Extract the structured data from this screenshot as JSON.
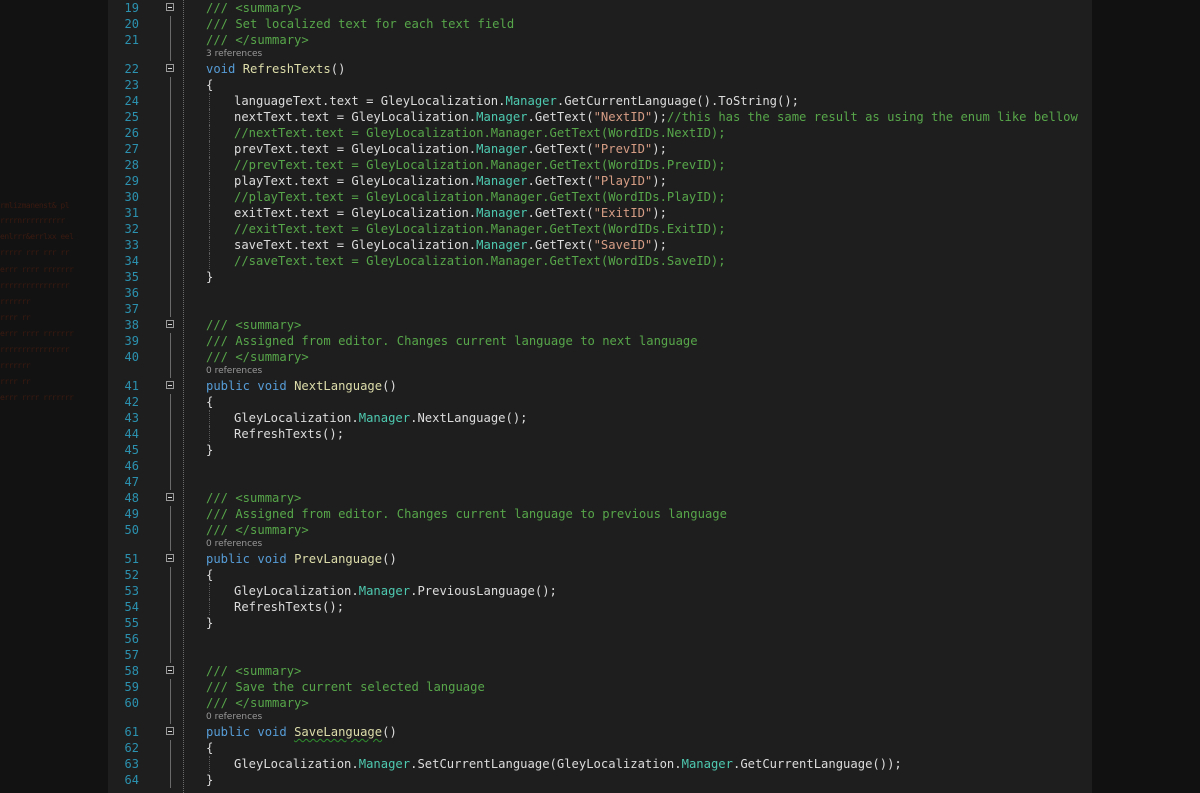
{
  "editor": {
    "lines": [
      {
        "num": "19",
        "fold": true,
        "indent": 0,
        "parts": [
          {
            "t": "/// <summary>",
            "c": "c"
          }
        ]
      },
      {
        "num": "20",
        "indent": 0,
        "parts": [
          {
            "t": "/// Set localized text for each text field",
            "c": "c"
          }
        ]
      },
      {
        "num": "21",
        "indent": 0,
        "parts": [
          {
            "t": "/// </summary>",
            "c": "c"
          }
        ]
      },
      {
        "lens": "3 references"
      },
      {
        "num": "22",
        "fold": true,
        "indent": 0,
        "parts": [
          {
            "t": "void ",
            "c": "k"
          },
          {
            "t": "RefreshTexts",
            "c": "m"
          },
          {
            "t": "()",
            "c": "p"
          }
        ]
      },
      {
        "num": "23",
        "indent": 0,
        "parts": [
          {
            "t": "{",
            "c": "p"
          }
        ]
      },
      {
        "num": "24",
        "indent": 1,
        "parts": [
          {
            "t": "languageText.text = GleyLocalization.",
            "c": "p"
          },
          {
            "t": "Manager",
            "c": "t"
          },
          {
            "t": ".GetCurrentLanguage().ToString();",
            "c": "p"
          }
        ]
      },
      {
        "num": "25",
        "indent": 1,
        "parts": [
          {
            "t": "nextText.text = GleyLocalization.",
            "c": "p"
          },
          {
            "t": "Manager",
            "c": "t"
          },
          {
            "t": ".GetText(",
            "c": "p"
          },
          {
            "t": "\"NextID\"",
            "c": "s"
          },
          {
            "t": ");",
            "c": "p"
          },
          {
            "t": "//this has the same result as using the enum like bellow",
            "c": "c"
          }
        ]
      },
      {
        "num": "26",
        "indent": 1,
        "parts": [
          {
            "t": "//nextText.text = GleyLocalization.Manager.GetText(WordIDs.NextID);",
            "c": "c"
          }
        ]
      },
      {
        "num": "27",
        "indent": 1,
        "parts": [
          {
            "t": "prevText.text = GleyLocalization.",
            "c": "p"
          },
          {
            "t": "Manager",
            "c": "t"
          },
          {
            "t": ".GetText(",
            "c": "p"
          },
          {
            "t": "\"PrevID\"",
            "c": "s"
          },
          {
            "t": ");",
            "c": "p"
          }
        ]
      },
      {
        "num": "28",
        "indent": 1,
        "parts": [
          {
            "t": "//prevText.text = GleyLocalization.Manager.GetText(WordIDs.PrevID);",
            "c": "c"
          }
        ]
      },
      {
        "num": "29",
        "indent": 1,
        "parts": [
          {
            "t": "playText.text = GleyLocalization.",
            "c": "p"
          },
          {
            "t": "Manager",
            "c": "t"
          },
          {
            "t": ".GetText(",
            "c": "p"
          },
          {
            "t": "\"PlayID\"",
            "c": "s"
          },
          {
            "t": ");",
            "c": "p"
          }
        ]
      },
      {
        "num": "30",
        "indent": 1,
        "parts": [
          {
            "t": "//playText.text = GleyLocalization.Manager.GetText(WordIDs.PlayID);",
            "c": "c"
          }
        ]
      },
      {
        "num": "31",
        "indent": 1,
        "parts": [
          {
            "t": "exitText.text = GleyLocalization.",
            "c": "p"
          },
          {
            "t": "Manager",
            "c": "t"
          },
          {
            "t": ".GetText(",
            "c": "p"
          },
          {
            "t": "\"ExitID\"",
            "c": "s"
          },
          {
            "t": ");",
            "c": "p"
          }
        ]
      },
      {
        "num": "32",
        "indent": 1,
        "parts": [
          {
            "t": "//exitText.text = GleyLocalization.Manager.GetText(WordIDs.ExitID);",
            "c": "c"
          }
        ]
      },
      {
        "num": "33",
        "indent": 1,
        "parts": [
          {
            "t": "saveText.text = GleyLocalization.",
            "c": "p"
          },
          {
            "t": "Manager",
            "c": "t"
          },
          {
            "t": ".GetText(",
            "c": "p"
          },
          {
            "t": "\"SaveID\"",
            "c": "s"
          },
          {
            "t": ");",
            "c": "p"
          }
        ]
      },
      {
        "num": "34",
        "indent": 1,
        "parts": [
          {
            "t": "//saveText.text = GleyLocalization.Manager.GetText(WordIDs.SaveID);",
            "c": "c"
          }
        ]
      },
      {
        "num": "35",
        "indent": 0,
        "parts": [
          {
            "t": "}",
            "c": "p"
          }
        ]
      },
      {
        "num": "36",
        "indent": 0,
        "parts": []
      },
      {
        "num": "37",
        "indent": 0,
        "parts": []
      },
      {
        "num": "38",
        "fold": true,
        "indent": 0,
        "parts": [
          {
            "t": "/// <summary>",
            "c": "c"
          }
        ]
      },
      {
        "num": "39",
        "indent": 0,
        "parts": [
          {
            "t": "/// Assigned from editor. Changes current language to next language",
            "c": "c"
          }
        ]
      },
      {
        "num": "40",
        "indent": 0,
        "parts": [
          {
            "t": "/// </summary>",
            "c": "c"
          }
        ]
      },
      {
        "lens": "0 references"
      },
      {
        "num": "41",
        "fold": true,
        "indent": 0,
        "parts": [
          {
            "t": "public ",
            "c": "k"
          },
          {
            "t": "void ",
            "c": "k"
          },
          {
            "t": "NextLanguage",
            "c": "m"
          },
          {
            "t": "()",
            "c": "p"
          }
        ]
      },
      {
        "num": "42",
        "indent": 0,
        "parts": [
          {
            "t": "{",
            "c": "p"
          }
        ]
      },
      {
        "num": "43",
        "indent": 1,
        "parts": [
          {
            "t": "GleyLocalization.",
            "c": "p"
          },
          {
            "t": "Manager",
            "c": "t"
          },
          {
            "t": ".NextLanguage();",
            "c": "p"
          }
        ]
      },
      {
        "num": "44",
        "indent": 1,
        "parts": [
          {
            "t": "RefreshTexts();",
            "c": "p"
          }
        ]
      },
      {
        "num": "45",
        "indent": 0,
        "parts": [
          {
            "t": "}",
            "c": "p"
          }
        ]
      },
      {
        "num": "46",
        "indent": 0,
        "parts": []
      },
      {
        "num": "47",
        "indent": 0,
        "parts": []
      },
      {
        "num": "48",
        "fold": true,
        "indent": 0,
        "parts": [
          {
            "t": "/// <summary>",
            "c": "c"
          }
        ]
      },
      {
        "num": "49",
        "indent": 0,
        "parts": [
          {
            "t": "/// Assigned from editor. Changes current language to previous language",
            "c": "c"
          }
        ]
      },
      {
        "num": "50",
        "indent": 0,
        "parts": [
          {
            "t": "/// </summary>",
            "c": "c"
          }
        ]
      },
      {
        "lens": "0 references"
      },
      {
        "num": "51",
        "fold": true,
        "indent": 0,
        "parts": [
          {
            "t": "public ",
            "c": "k"
          },
          {
            "t": "void ",
            "c": "k"
          },
          {
            "t": "PrevLanguage",
            "c": "m"
          },
          {
            "t": "()",
            "c": "p"
          }
        ]
      },
      {
        "num": "52",
        "indent": 0,
        "parts": [
          {
            "t": "{",
            "c": "p"
          }
        ]
      },
      {
        "num": "53",
        "indent": 1,
        "parts": [
          {
            "t": "GleyLocalization.",
            "c": "p"
          },
          {
            "t": "Manager",
            "c": "t"
          },
          {
            "t": ".PreviousLanguage();",
            "c": "p"
          }
        ]
      },
      {
        "num": "54",
        "indent": 1,
        "parts": [
          {
            "t": "RefreshTexts();",
            "c": "p"
          }
        ]
      },
      {
        "num": "55",
        "indent": 0,
        "parts": [
          {
            "t": "}",
            "c": "p"
          }
        ]
      },
      {
        "num": "56",
        "indent": 0,
        "parts": []
      },
      {
        "num": "57",
        "indent": 0,
        "parts": []
      },
      {
        "num": "58",
        "fold": true,
        "indent": 0,
        "parts": [
          {
            "t": "/// <summary>",
            "c": "c"
          }
        ]
      },
      {
        "num": "59",
        "indent": 0,
        "parts": [
          {
            "t": "/// Save the current selected language",
            "c": "c"
          }
        ]
      },
      {
        "num": "60",
        "indent": 0,
        "parts": [
          {
            "t": "/// </summary>",
            "c": "c"
          }
        ]
      },
      {
        "lens": "0 references"
      },
      {
        "num": "61",
        "fold": true,
        "indent": 0,
        "parts": [
          {
            "t": "public ",
            "c": "k"
          },
          {
            "t": "void ",
            "c": "k"
          },
          {
            "t": "SaveLanguage",
            "c": "m",
            "squig": true
          },
          {
            "t": "()",
            "c": "p"
          }
        ]
      },
      {
        "num": "62",
        "indent": 0,
        "parts": [
          {
            "t": "{",
            "c": "p"
          }
        ]
      },
      {
        "num": "63",
        "indent": 1,
        "parts": [
          {
            "t": "GleyLocalization.",
            "c": "p"
          },
          {
            "t": "Manager",
            "c": "t"
          },
          {
            "t": ".SetCurrentLanguage(GleyLocalization.",
            "c": "p"
          },
          {
            "t": "Manager",
            "c": "t"
          },
          {
            "t": ".GetCurrentLanguage());",
            "c": "p"
          }
        ]
      },
      {
        "num": "64",
        "indent": 0,
        "parts": [
          {
            "t": "}",
            "c": "p"
          }
        ]
      }
    ]
  },
  "colors": {
    "background": "#1e1e1e",
    "line_number": "#2b91af",
    "comment": "#57a64a",
    "keyword": "#569cd6",
    "method": "#dcdcaa",
    "type": "#4ec9b0",
    "string": "#d69d85",
    "text": "#dcdcdc"
  }
}
